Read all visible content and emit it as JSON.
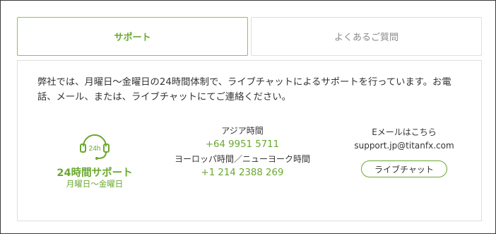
{
  "tabs": {
    "support_label": "サポート",
    "faq_label": "よくあるご質問"
  },
  "intro": {
    "text": "弊社では、月曜日～金曜日の24時間体制で、ライブチャットによるサポートを行っています。お電話、メール、または、ライブチャットにてご連絡ください。"
  },
  "badge": {
    "icon": "headset-24h-icon",
    "icon_text": "24h",
    "title": "24時間サポート",
    "subtitle": "月曜日～金曜日"
  },
  "phone": {
    "asia_label": "アジア時間",
    "asia_number": "+64 9951 5711",
    "eu_ny_label": "ヨーロッパ時間／ニューヨーク時間",
    "eu_ny_number": "+1 214 2388 269"
  },
  "contact": {
    "email_label": "Eメールはこちら",
    "email_address": "support.jp@titanfx.com",
    "chat_button_label": "ライブチャット"
  },
  "colors": {
    "accent": "#6aa82e",
    "accent_border": "#8cc63f",
    "text": "#333333",
    "muted": "#8a8a8a",
    "border": "#dedede"
  }
}
